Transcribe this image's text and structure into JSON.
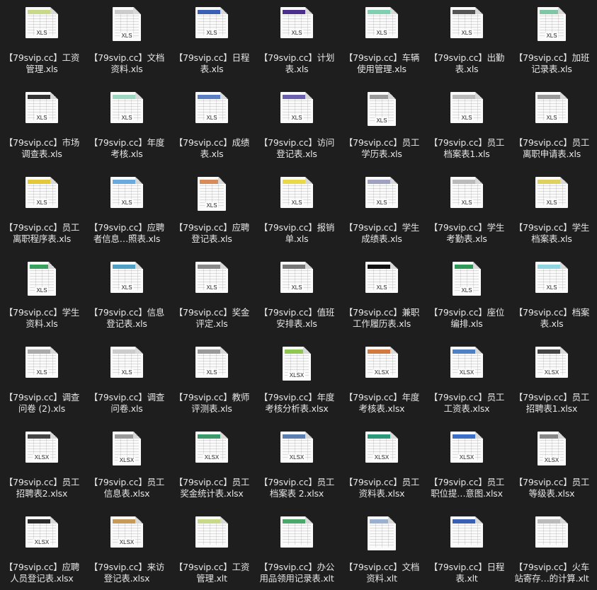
{
  "colors": {
    "background": "#1e1e1e",
    "label_text": "#e6e6e6",
    "page": "#fafafa"
  },
  "files": [
    {
      "line1": "【79svip.cc】工资",
      "line2": "管理.xls",
      "badge": "XLS",
      "accent": "#c9d98a",
      "icon": "spreadsheet-icon"
    },
    {
      "line1": "【79svip.cc】文档",
      "line2": "资料.xls",
      "badge": "XLS",
      "accent": "#cccccc",
      "icon": "spreadsheet-icon"
    },
    {
      "line1": "【79svip.cc】日程",
      "line2": "表.xls",
      "badge": "XLS",
      "accent": "#3a5fb5",
      "icon": "spreadsheet-icon"
    },
    {
      "line1": "【79svip.cc】计划",
      "line2": "表.xls",
      "badge": "XLS",
      "accent": "#4a2f8c",
      "icon": "spreadsheet-icon"
    },
    {
      "line1": "【79svip.cc】车辆",
      "line2": "使用管理.xls",
      "badge": "XLS",
      "accent": "#7fd0b0",
      "icon": "spreadsheet-icon"
    },
    {
      "line1": "【79svip.cc】出勤",
      "line2": "表.xls",
      "badge": "XLS",
      "accent": "#555555",
      "icon": "spreadsheet-icon"
    },
    {
      "line1": "【79svip.cc】加班",
      "line2": "记录表.xls",
      "badge": "XLS",
      "accent": "#7ec6a4",
      "icon": "spreadsheet-icon"
    },
    {
      "line1": "【79svip.cc】市场",
      "line2": "调查表.xls",
      "badge": "XLS",
      "accent": "#333333",
      "icon": "spreadsheet-icon"
    },
    {
      "line1": "【79svip.cc】年度",
      "line2": "考核.xls",
      "badge": "XLS",
      "accent": "#9fd6c2",
      "icon": "spreadsheet-icon"
    },
    {
      "line1": "【79svip.cc】成绩",
      "line2": "表.xls",
      "badge": "XLS",
      "accent": "#5b7fc4",
      "icon": "spreadsheet-icon"
    },
    {
      "line1": "【79svip.cc】访问",
      "line2": "登记表.xls",
      "badge": "XLS",
      "accent": "#6b5fb0",
      "icon": "spreadsheet-icon"
    },
    {
      "line1": "【79svip.cc】员工",
      "line2": "学历表.xls",
      "badge": "XLS",
      "accent": "#9a9a9a",
      "icon": "spreadsheet-icon"
    },
    {
      "line1": "【79svip.cc】员工",
      "line2": "档案表1.xls",
      "badge": "XLS",
      "accent": "#bbbbbb",
      "icon": "spreadsheet-icon"
    },
    {
      "line1": "【79svip.cc】员工",
      "line2": "离职申请表.xls",
      "badge": "XLS",
      "accent": "#999999",
      "icon": "spreadsheet-icon"
    },
    {
      "line1": "【79svip.cc】员工",
      "line2": "离职程序表.xls",
      "badge": "XLS",
      "accent": "#e3c83a",
      "icon": "spreadsheet-icon"
    },
    {
      "line1": "【79svip.cc】应聘",
      "line2": "者信息…照表.xls",
      "badge": "XLS",
      "accent": "#6aa8e0",
      "icon": "spreadsheet-icon"
    },
    {
      "line1": "【79svip.cc】应聘",
      "line2": "登记表.xls",
      "badge": "XLS",
      "accent": "#d98a5a",
      "icon": "spreadsheet-icon"
    },
    {
      "line1": "【79svip.cc】报销",
      "line2": "单.xls",
      "badge": "XLS",
      "accent": "#e8d84a",
      "icon": "spreadsheet-icon"
    },
    {
      "line1": "【79svip.cc】学生",
      "line2": "成绩表.xls",
      "badge": "XLS",
      "accent": "#a0a0c0",
      "icon": "spreadsheet-icon"
    },
    {
      "line1": "【79svip.cc】学生",
      "line2": "考勤表.xls",
      "badge": "XLS",
      "accent": "#bbbbbb",
      "icon": "spreadsheet-icon"
    },
    {
      "line1": "【79svip.cc】学生",
      "line2": "档案表.xls",
      "badge": "XLS",
      "accent": "#e0d060",
      "icon": "spreadsheet-icon"
    },
    {
      "line1": "【79svip.cc】学生",
      "line2": "资料.xls",
      "badge": "XLS",
      "accent": "#3aa060",
      "icon": "spreadsheet-icon"
    },
    {
      "line1": "【79svip.cc】信息",
      "line2": "登记表.xls",
      "badge": "XLS",
      "accent": "#4fa0c8",
      "icon": "spreadsheet-icon"
    },
    {
      "line1": "【79svip.cc】奖金",
      "line2": "评定.xls",
      "badge": "XLS",
      "accent": "#888888",
      "icon": "spreadsheet-icon"
    },
    {
      "line1": "【79svip.cc】值班",
      "line2": "安排表.xls",
      "badge": "XLS",
      "accent": "#777777",
      "icon": "spreadsheet-icon"
    },
    {
      "line1": "【79svip.cc】兼职",
      "line2": "工作履历表.xls",
      "badge": "XLS",
      "accent": "#111111",
      "icon": "spreadsheet-icon"
    },
    {
      "line1": "【79svip.cc】座位",
      "line2": "编排.xls",
      "badge": "XLS",
      "accent": "#2f9a55",
      "icon": "spreadsheet-icon"
    },
    {
      "line1": "【79svip.cc】档案",
      "line2": "表.xls",
      "badge": "XLS",
      "accent": "#8fd6e0",
      "icon": "spreadsheet-icon"
    },
    {
      "line1": "【79svip.cc】调查",
      "line2": "问卷 (2).xls",
      "badge": "XLS",
      "accent": "#aaaaaa",
      "icon": "spreadsheet-icon"
    },
    {
      "line1": "【79svip.cc】调查",
      "line2": "问卷.xls",
      "badge": "XLS",
      "accent": "#cccccc",
      "icon": "spreadsheet-icon"
    },
    {
      "line1": "【79svip.cc】教师",
      "line2": "评测表.xls",
      "badge": "XLS",
      "accent": "#999999",
      "icon": "spreadsheet-icon"
    },
    {
      "line1": "【79svip.cc】年度",
      "line2": "考核分析表.xlsx",
      "badge": "XLSX",
      "accent": "#8fc850",
      "icon": "spreadsheet-icon"
    },
    {
      "line1": "【79svip.cc】年度",
      "line2": "考核表.xlsx",
      "badge": "XLSX",
      "accent": "#d07a40",
      "icon": "spreadsheet-icon"
    },
    {
      "line1": "【79svip.cc】员工",
      "line2": "工资表.xlsx",
      "badge": "XLSX",
      "accent": "#4f7fc4",
      "icon": "spreadsheet-icon"
    },
    {
      "line1": "【79svip.cc】员工",
      "line2": "招聘表1.xlsx",
      "badge": "XLSX",
      "accent": "#444444",
      "icon": "spreadsheet-icon"
    },
    {
      "line1": "【79svip.cc】员工",
      "line2": "招聘表2.xlsx",
      "badge": "XLSX",
      "accent": "#444444",
      "icon": "spreadsheet-icon"
    },
    {
      "line1": "【79svip.cc】员工",
      "line2": "信息表.xlsx",
      "badge": "XLSX",
      "accent": "#999999",
      "icon": "spreadsheet-icon"
    },
    {
      "line1": "【79svip.cc】员工",
      "line2": "奖金统计表.xlsx",
      "badge": "XLSX",
      "accent": "#3a9a6a",
      "icon": "spreadsheet-icon"
    },
    {
      "line1": "【79svip.cc】员工",
      "line2": "档案表 2.xlsx",
      "badge": "XLSX",
      "accent": "#5a7fb0",
      "icon": "spreadsheet-icon"
    },
    {
      "line1": "【79svip.cc】员工",
      "line2": "资料表.xlsx",
      "badge": "XLSX",
      "accent": "#2a9a7a",
      "icon": "spreadsheet-icon"
    },
    {
      "line1": "【79svip.cc】员工",
      "line2": "职位提…意图.xlsx",
      "badge": "XLSX",
      "accent": "#3a70c8",
      "icon": "spreadsheet-icon"
    },
    {
      "line1": "【79svip.cc】员工",
      "line2": "等级表.xlsx",
      "badge": "XLSX",
      "accent": "#888888",
      "icon": "spreadsheet-icon"
    },
    {
      "line1": "【79svip.cc】应聘",
      "line2": "人员登记表.xlsx",
      "badge": "XLSX",
      "accent": "#2a2a2a",
      "icon": "spreadsheet-icon"
    },
    {
      "line1": "【79svip.cc】来访",
      "line2": "登记表.xlsx",
      "badge": "XLSX",
      "accent": "#c89a5a",
      "icon": "spreadsheet-icon"
    },
    {
      "line1": "【79svip.cc】工资",
      "line2": "管理.xlt",
      "badge": "",
      "accent": "#c9d98a",
      "icon": "spreadsheet-template-icon"
    },
    {
      "line1": "【79svip.cc】办公",
      "line2": "用品领用记录表.xlt",
      "badge": "",
      "accent": "#4aa86a",
      "icon": "spreadsheet-template-icon"
    },
    {
      "line1": "【79svip.cc】文档",
      "line2": "资料.xlt",
      "badge": "",
      "accent": "#9ab0d0",
      "icon": "spreadsheet-template-icon"
    },
    {
      "line1": "【79svip.cc】日程",
      "line2": "表.xlt",
      "badge": "",
      "accent": "#3a5fb5",
      "icon": "spreadsheet-template-icon"
    },
    {
      "line1": "【79svip.cc】火车",
      "line2": "站寄存…的计算.xlt",
      "badge": "",
      "accent": "#bbbbbb",
      "icon": "spreadsheet-template-icon"
    }
  ]
}
